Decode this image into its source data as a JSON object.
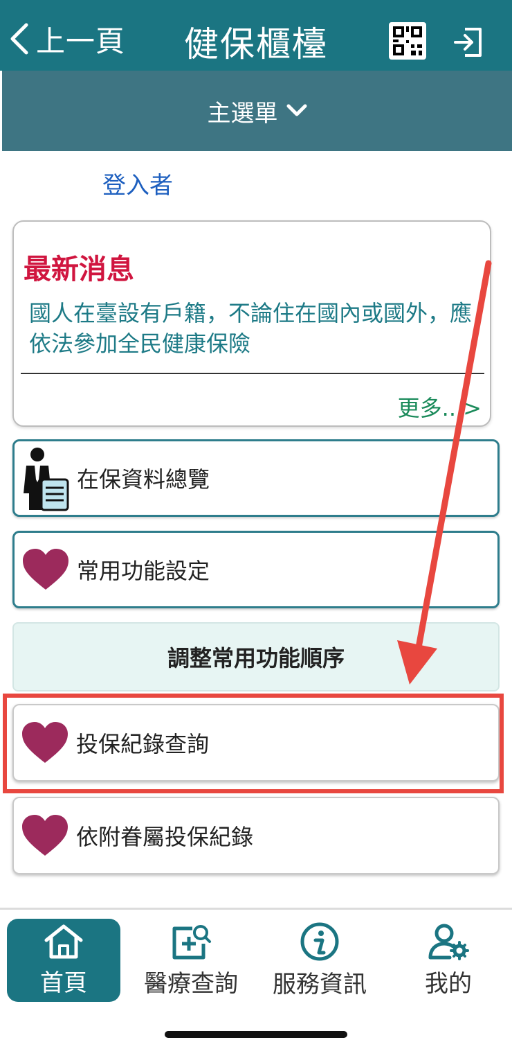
{
  "header": {
    "back_label": "上一頁",
    "title": "健保櫃檯",
    "qr_icon": "qr-code-icon",
    "logout_icon": "logout-icon",
    "bg_color": "#1b7582"
  },
  "menu": {
    "label": "主選單",
    "icon": "chevron-down-icon"
  },
  "user": {
    "login_label": "登入者"
  },
  "news": {
    "title": "最新消息",
    "text": "國人在臺設有戶籍，不論住在國內或國外，應依法參加全民健康保險",
    "more": "更多...>"
  },
  "features": [
    {
      "label": "在保資料總覽",
      "icon": "insured-person-document-icon"
    },
    {
      "label": "常用功能設定",
      "icon": "heart-icon"
    }
  ],
  "order_button": {
    "label": "調整常用功能順序"
  },
  "favorites": [
    {
      "label": "投保紀錄查詢",
      "icon": "heart-icon"
    },
    {
      "label": "依附眷屬投保紀錄",
      "icon": "heart-icon"
    }
  ],
  "tabs": [
    {
      "label": "首頁",
      "icon": "home-icon",
      "active": true
    },
    {
      "label": "醫療查詢",
      "icon": "medical-search-icon",
      "active": false
    },
    {
      "label": "服務資訊",
      "icon": "info-icon",
      "active": false
    },
    {
      "label": "我的",
      "icon": "user-settings-icon",
      "active": false
    }
  ],
  "annotation": {
    "color": "#e8473f"
  }
}
